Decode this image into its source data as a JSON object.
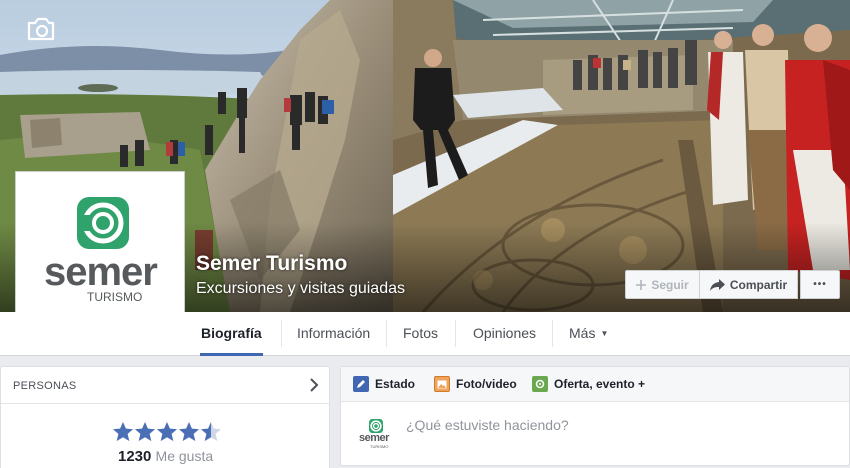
{
  "page": {
    "name": "Semer Turismo",
    "category": "Excursiones y visitas guiadas"
  },
  "logo": {
    "word": "semer",
    "sub": "TURISMO",
    "color_green": "#2fa36b",
    "color_gray": "#565a5c"
  },
  "cover_actions": {
    "follow": "Seguir",
    "share": "Compartir",
    "more": "•••"
  },
  "tabs": [
    {
      "label": "Biografía",
      "active": true
    },
    {
      "label": "Información",
      "active": false
    },
    {
      "label": "Fotos",
      "active": false
    },
    {
      "label": "Opiniones",
      "active": false
    },
    {
      "label": "Más",
      "active": false
    }
  ],
  "people_card": {
    "title": "PERSONAS",
    "rating": 4.5,
    "likes_count": "1230",
    "likes_label": "Me gusta"
  },
  "composer": {
    "tabs": [
      "Estado",
      "Foto/video",
      "Oferta, evento +"
    ],
    "placeholder": "¿Qué estuviste haciendo?",
    "mini_logo_word": "semer",
    "mini_logo_sub": "TURISMO"
  },
  "icons": {
    "cover_camera": "camera-icon",
    "profile_camera": "camera-icon",
    "follow": "plus-icon",
    "share": "share-arrow-icon",
    "chevron": "chevron-right-icon",
    "status": "pencil-icon",
    "photo": "photo-icon",
    "offer": "offer-icon"
  },
  "colors": {
    "accent": "#4267b2",
    "star": "#4a6fb5",
    "background": "#e9ebee"
  }
}
